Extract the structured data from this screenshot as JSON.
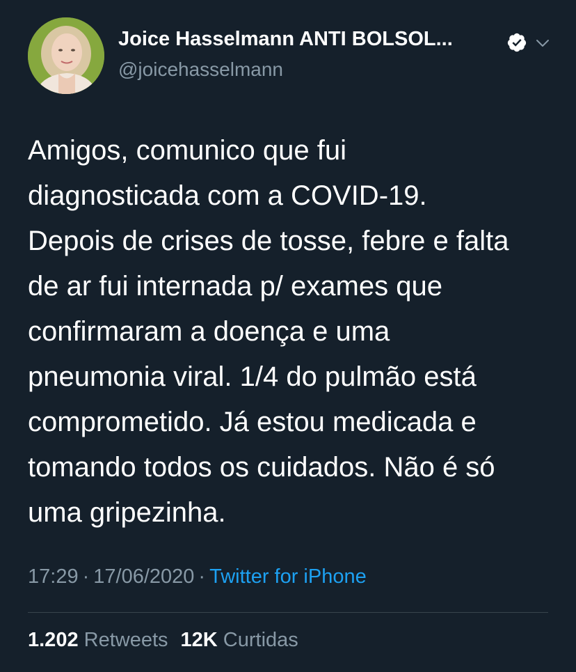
{
  "user": {
    "display_name": "Joice Hasselmann ANTI BOLSOL...",
    "handle": "@joicehasselmann",
    "avatar_icon": "profile-photo",
    "verified_icon": "verified-badge-icon"
  },
  "tweet": {
    "text": "Amigos, comunico que fui\ndiagnosticada com a COVID-19.\nDepois de crises de tosse, febre e falta\nde ar fui internada p/ exames que\nconfirmaram a doença e uma\npneumonia viral. 1/4 do pulmão está\ncomprometido. Já estou medicada e\ntomando todos os cuidados. Não é só\numa gripezinha.",
    "time": "17:29",
    "separator": "·",
    "date": "17/06/2020",
    "source": "Twitter for iPhone"
  },
  "stats": {
    "retweets_count": "1.202",
    "retweets_label": "Retweets",
    "likes_count": "12K",
    "likes_label": "Curtidas"
  },
  "colors": {
    "background": "#15202b",
    "text_primary": "#ffffff",
    "text_secondary": "#8899a6",
    "link": "#1da1f2",
    "divider": "#38444d"
  }
}
